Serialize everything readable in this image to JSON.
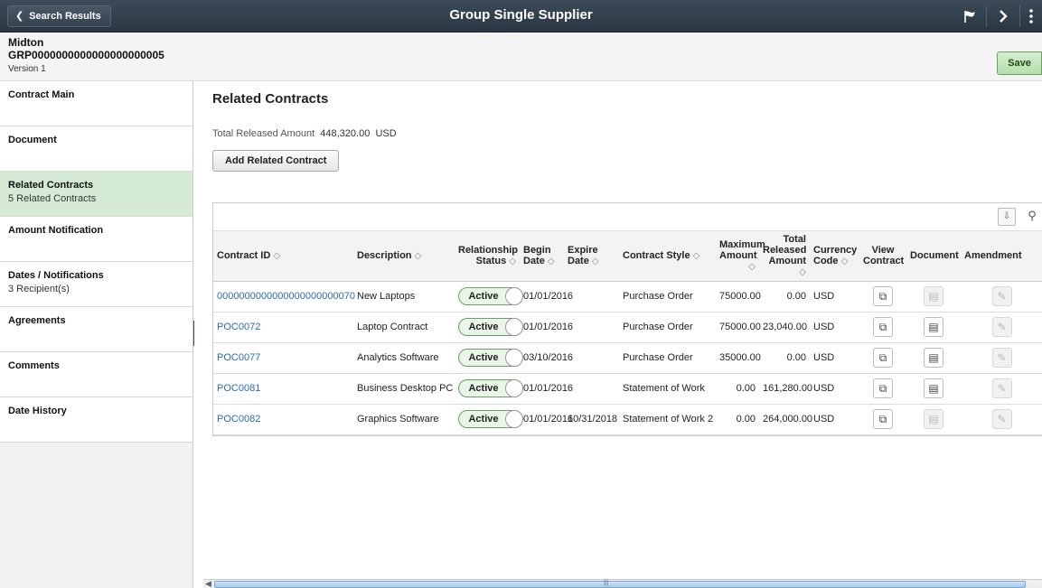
{
  "banner": {
    "back_label": "Search Results",
    "title": "Group Single Supplier",
    "icons": [
      "flag-icon",
      "chevron-right-icon",
      "kebab-menu-icon"
    ]
  },
  "header": {
    "name": "Midton",
    "id": "GRP0000000000000000000005",
    "version": "Version 1",
    "save_label": "Save"
  },
  "sidebar": {
    "items": [
      {
        "label": "Contract Main",
        "sub": ""
      },
      {
        "label": "Document",
        "sub": ""
      },
      {
        "label": "Related Contracts",
        "sub": "5 Related Contracts"
      },
      {
        "label": "Amount Notification",
        "sub": ""
      },
      {
        "label": "Dates / Notifications",
        "sub": "3 Recipient(s)"
      },
      {
        "label": "Agreements",
        "sub": ""
      },
      {
        "label": "Comments",
        "sub": ""
      },
      {
        "label": "Date History",
        "sub": ""
      }
    ],
    "selected_index": 2
  },
  "main": {
    "title": "Related Contracts",
    "total_label": "Total Released Amount",
    "total_value": "448,320.00",
    "total_currency": "USD",
    "add_button": "Add Related Contract"
  },
  "grid": {
    "columns": {
      "contract_id": "Contract ID",
      "description": "Description",
      "rel_status_1": "Relationship",
      "rel_status_2": "Status",
      "begin_1": "Begin",
      "begin_2": "Date",
      "expire_1": "Expire",
      "expire_2": "Date",
      "style": "Contract Style",
      "max_1": "Maximum",
      "max_2": "Amount",
      "total_1": "Total",
      "total_2": "Released",
      "total_3": "Amount",
      "currency_1": "Currency",
      "currency_2": "Code",
      "view_1": "View",
      "view_2": "Contract",
      "document": "Document",
      "amendment": "Amendment"
    },
    "rows": [
      {
        "id": "0000000000000000000000070",
        "description": "New Laptops",
        "status": "Active",
        "begin": "01/01/2016",
        "expire": "",
        "style": "Purchase Order",
        "max": "75000.00",
        "total": "0.00",
        "currency": "USD",
        "doc_enabled": false
      },
      {
        "id": "POC0072",
        "description": "Laptop Contract",
        "status": "Active",
        "begin": "01/01/2016",
        "expire": "",
        "style": "Purchase Order",
        "max": "75000.00",
        "total": "23,040.00",
        "currency": "USD",
        "doc_enabled": true
      },
      {
        "id": "POC0077",
        "description": "Analytics Software",
        "status": "Active",
        "begin": "03/10/2016",
        "expire": "",
        "style": "Purchase Order",
        "max": "35000.00",
        "total": "0.00",
        "currency": "USD",
        "doc_enabled": true
      },
      {
        "id": "POC0081",
        "description": "Business Desktop PC",
        "status": "Active",
        "begin": "01/01/2016",
        "expire": "",
        "style": "Statement of Work",
        "max": "0.00",
        "total": "161,280.00",
        "currency": "USD",
        "doc_enabled": true
      },
      {
        "id": "POC0082",
        "description": "Graphics Software",
        "status": "Active",
        "begin": "01/01/2016",
        "expire": "10/31/2018",
        "style": "Statement of Work 2",
        "max": "0.00",
        "total": "264,000.00",
        "currency": "USD",
        "doc_enabled": false
      }
    ]
  }
}
